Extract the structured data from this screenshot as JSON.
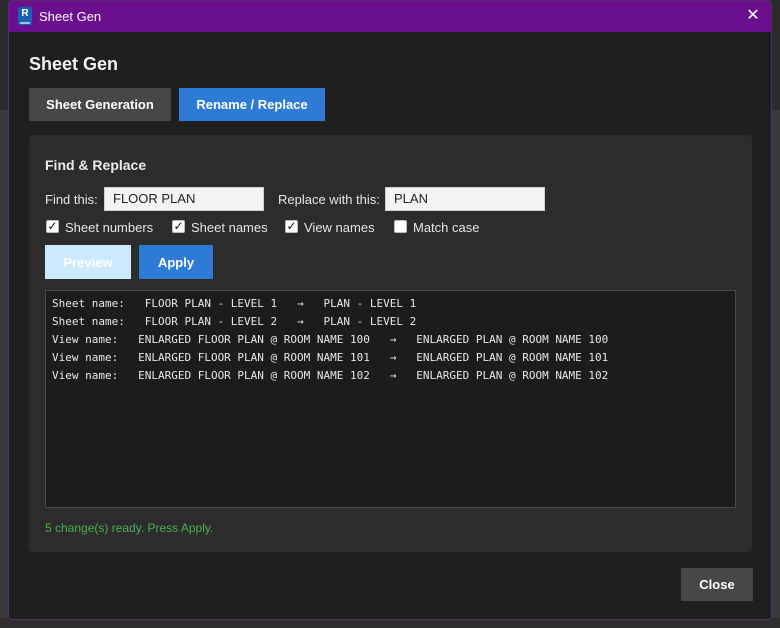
{
  "window": {
    "title": "Sheet Gen",
    "app_icon": "revit-icon",
    "app_icon_letter": "R",
    "close_icon": "close-icon",
    "close_glyph": "✕"
  },
  "heading": "Sheet Gen",
  "tabs": [
    {
      "label": "Sheet Generation",
      "active": false
    },
    {
      "label": "Rename / Replace",
      "active": true
    }
  ],
  "panel": {
    "title": "Find & Replace",
    "find_label": "Find this:",
    "find_value": "FLOOR PLAN",
    "replace_label": "Replace with this:",
    "replace_value": "PLAN",
    "options": [
      {
        "label": "Sheet numbers",
        "checked": true
      },
      {
        "label": "Sheet names",
        "checked": true
      },
      {
        "label": "View names",
        "checked": true
      },
      {
        "label": "Match case",
        "checked": false
      }
    ],
    "check_glyph": "✓",
    "preview_label": "Preview",
    "apply_label": "Apply",
    "output_lines": [
      "Sheet name:   FLOOR PLAN - LEVEL 1   →   PLAN - LEVEL 1",
      "Sheet name:   FLOOR PLAN - LEVEL 2   →   PLAN - LEVEL 2",
      "View name:   ENLARGED FLOOR PLAN @ ROOM NAME 100   →   ENLARGED PLAN @ ROOM NAME 100",
      "View name:   ENLARGED FLOOR PLAN @ ROOM NAME 101   →   ENLARGED PLAN @ ROOM NAME 101",
      "View name:   ENLARGED FLOOR PLAN @ ROOM NAME 102   →   ENLARGED PLAN @ ROOM NAME 102"
    ],
    "status": "5 change(s) ready. Press Apply."
  },
  "close_label": "Close",
  "colors": {
    "titlebar": "#6a0f8e",
    "accent": "#2e7bd6",
    "status_ok": "#4caf50"
  }
}
